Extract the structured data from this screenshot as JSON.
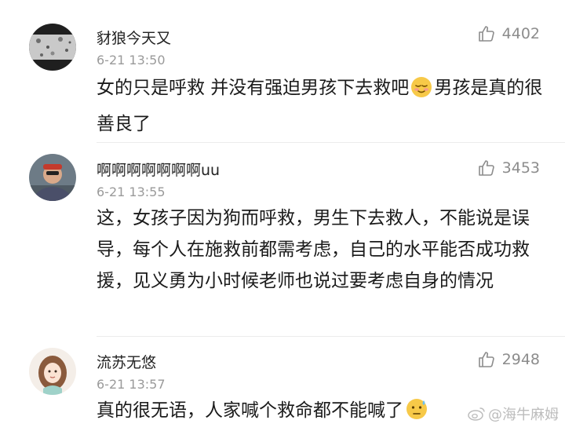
{
  "comments": [
    {
      "username": "豺狼今天又",
      "time": "6-21 13:50",
      "likes": "4402",
      "text_before_emoji": "女的只是呼救 并没有强迫男孩下去救吧",
      "emoji": "relieved-face-emoji",
      "text_after_emoji": "男孩是真的很善良了"
    },
    {
      "username": "啊啊啊啊啊啊啊uu",
      "time": "6-21 13:55",
      "likes": "3453",
      "text": "这，女孩子因为狗而呼救，男生下去救人，不能说是误导，每个人在施救前都需考虑，自己的水平能否成功救援，见义勇为小时候老师也说过要考虑自身的情况"
    },
    {
      "username": "流苏无悠",
      "time": "6-21 13:57",
      "likes": "2948",
      "text": "真的很无语，人家喊个救命都不能喊了",
      "emoji": "sweat-face-emoji"
    }
  ],
  "watermark": {
    "text": "@海牛麻姆",
    "icon": "weibo-logo-icon"
  },
  "colors": {
    "text": "#1b1b1b",
    "meta": "#9a9a9a",
    "emoji_yellow": "#f7c948"
  }
}
